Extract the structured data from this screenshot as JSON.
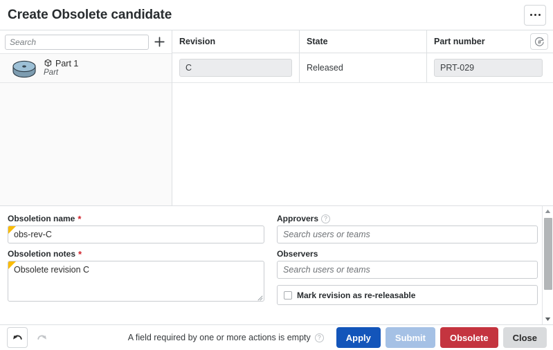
{
  "window": {
    "title": "Create Obsolete candidate",
    "kebab_label": "•••",
    "kebab_name": "more-options"
  },
  "tree": {
    "search_placeholder": "Search",
    "search_value": "",
    "add_label": "+",
    "rows": [
      {
        "name": "Part 1",
        "type": "Part",
        "thumbnail": "part-cylinder-thumbnail"
      }
    ]
  },
  "table": {
    "columns": [
      {
        "key": "revision",
        "label": "Revision"
      },
      {
        "key": "state",
        "label": "State"
      },
      {
        "key": "part_number",
        "label": "Part number"
      }
    ],
    "autonumber_icon": "auto-number-icon",
    "rows": [
      {
        "revision": "C",
        "state": "Released",
        "part_number": "PRT-029"
      }
    ]
  },
  "form": {
    "left": {
      "obsoletion_name": {
        "label": "Obsoletion name",
        "required_marker": "*",
        "value": "obs-rev-C"
      },
      "obsoletion_notes": {
        "label": "Obsoletion notes",
        "required_marker": "*",
        "value": "Obsolete revision C"
      }
    },
    "right": {
      "approvers": {
        "label": "Approvers",
        "help_glyph": "?",
        "placeholder": "Search users or teams",
        "value": ""
      },
      "observers": {
        "label": "Observers",
        "placeholder": "Search users or teams",
        "value": ""
      },
      "re_releasable": {
        "label": "Mark revision as re-releasable",
        "checked": false
      }
    }
  },
  "footer": {
    "undo_label": "undo-arrow",
    "redo_label": "redo-arrow",
    "status_text": "A field required by one or more actions is empty",
    "status_help_glyph": "?",
    "buttons": [
      {
        "key": "apply",
        "label": "Apply"
      },
      {
        "key": "submit",
        "label": "Submit"
      },
      {
        "key": "obsolete",
        "label": "Obsolete"
      },
      {
        "key": "close",
        "label": "Close"
      }
    ]
  },
  "colors": {
    "accent_blue": "#1355ba",
    "submit_disabled_blue": "#a5c1e5",
    "danger_red": "#c4343f",
    "neutral_gray": "#d9dbdd",
    "required_red": "#d0212a",
    "dirty_yellow": "#fbbc05",
    "panel_bg": "#fafafa",
    "border": "#dcdfe2"
  }
}
